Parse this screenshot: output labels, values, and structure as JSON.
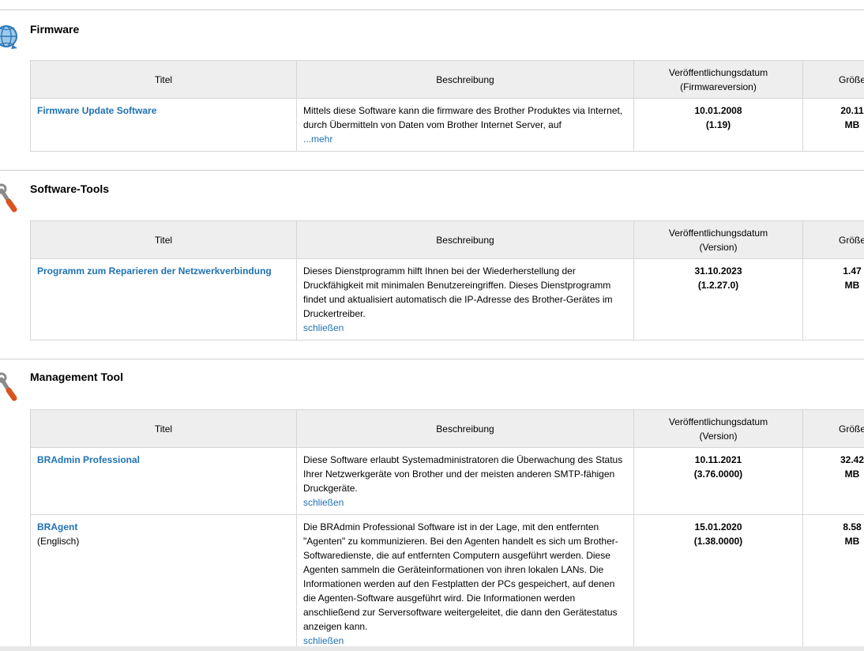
{
  "headers": {
    "title": "Titel",
    "description": "Beschreibung",
    "date_firmware_line1": "Veröffentlichungsdatum",
    "date_firmware_line2": "(Firmwareversion)",
    "date_version_line1": "Veröffentlichungsdatum",
    "date_version_line2": "(Version)",
    "size": "Größe"
  },
  "sections": [
    {
      "title": "Firmware",
      "icon": "globe-update-icon",
      "rows": [
        {
          "title": "Firmware Update Software",
          "subtitle": "",
          "description": "Mittels diese Software kann die firmware des Brother Produktes via Internet, durch Übermitteln von Daten vom Brother Internet Server, auf",
          "toggle": "...mehr",
          "date": "10.01.2008",
          "version": "(1.19)",
          "size_value": "20.11",
          "size_unit": "MB"
        }
      ]
    },
    {
      "title": "Software-Tools",
      "icon": "wrench-icon",
      "rows": [
        {
          "title": "Programm zum Reparieren der Netzwerkverbindung",
          "subtitle": "",
          "description": "Dieses Dienstprogramm hilft Ihnen bei der Wiederherstellung der Druckfähigkeit mit minimalen Benutzereingriffen. Dieses Dienstprogramm findet und aktualisiert automatisch die IP-Adresse des Brother-Gerätes im Druckertreiber.",
          "toggle": "schließen",
          "date": "31.10.2023",
          "version": "(1.2.27.0)",
          "size_value": "1.47",
          "size_unit": "MB"
        }
      ]
    },
    {
      "title": "Management Tool",
      "icon": "wrench-icon",
      "rows": [
        {
          "title": "BRAdmin Professional",
          "subtitle": "",
          "description": "Diese Software erlaubt Systemadministratoren die Überwachung des Status Ihrer Netzwerkgeräte von Brother und der meisten anderen SMTP-fähigen Druckgeräte.",
          "toggle": "schließen",
          "date": "10.11.2021",
          "version": "(3.76.0000)",
          "size_value": "32.42",
          "size_unit": "MB"
        },
        {
          "title": "BRAgent",
          "subtitle": "(Englisch)",
          "description": "Die BRAdmin Professional Software ist in der Lage, mit den entfernten \"Agenten\" zu kommunizieren. Bei den Agenten handelt es sich um Brother-Softwaredienste, die auf entfernten Computern ausgeführt werden. Diese Agenten sammeln die Geräteinformationen von ihren lokalen LANs. Die Informationen werden auf den Festplatten der PCs gespeichert, auf denen die Agenten-Software ausgeführt wird. Die Informationen werden anschließend zur Serversoftware weitergeleitet, die dann den Gerätestatus anzeigen kann.",
          "toggle": "schließen",
          "date": "15.01.2020",
          "version": "(1.38.0000)",
          "size_value": "8.58",
          "size_unit": "MB"
        }
      ]
    }
  ]
}
